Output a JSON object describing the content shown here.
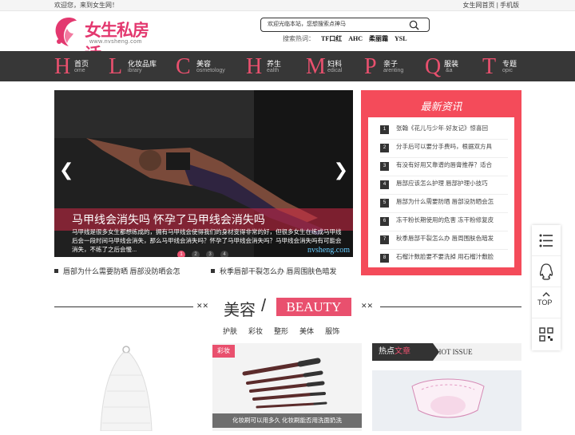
{
  "topbar": {
    "welcome": "欢迎您，来到女生网！",
    "home_link": "女生网首页",
    "sep": " | ",
    "mobile_link": "手机版"
  },
  "logo": {
    "title": "女生私房话",
    "url": "www.nvsheng.com"
  },
  "search": {
    "placeholder": "欢迎光临本站，您想搜索点神马",
    "hot_label": "搜索热词：",
    "hot_words": [
      "TF口红",
      "AHC",
      "柔丽霜",
      "YSL"
    ]
  },
  "nav": [
    {
      "letter": "H",
      "cn": "首页",
      "en": "ome"
    },
    {
      "letter": "L",
      "cn": "化妆品库",
      "en": "ibrary"
    },
    {
      "letter": "C",
      "cn": "美容",
      "en": "osmetology"
    },
    {
      "letter": "H",
      "cn": "养生",
      "en": "ealth"
    },
    {
      "letter": "M",
      "cn": "妇科",
      "en": "edical"
    },
    {
      "letter": "P",
      "cn": "亲子",
      "en": "arenting"
    },
    {
      "letter": "Q",
      "cn": "服装",
      "en": "&a"
    },
    {
      "letter": "T",
      "cn": "专题",
      "en": "opic"
    }
  ],
  "slider": {
    "title": "马甲线会消失吗 怀孕了马甲线会消失吗",
    "desc": "马甲线是很多女生都想练成的，拥有马甲线会使得我们的身材变得非常的好，但很多女生在练成马甲线后会一段时间马甲线会消失，那么马甲线会消失吗？怀孕了马甲线会消失吗？马甲线会消失吗有可能会消失，不练了之后会慢...",
    "dots": [
      "1",
      "2",
      "3",
      "4"
    ],
    "watermark": "nvsheng.com",
    "prev": "❮",
    "next": "❯"
  },
  "links": [
    "唇部为什么需要防晒 唇部没防晒会怎",
    "秋季唇部干裂怎么办 唇周围肤色暗发"
  ],
  "news": {
    "heading": "最新资讯",
    "items": [
      {
        "n": "1",
        "text": "张翰《花儿与少年·好友记》惊喜回"
      },
      {
        "n": "2",
        "text": "分手后可以要分手费吗，根据双方具"
      },
      {
        "n": "3",
        "text": "有没有好用又靠谱的唇膏推荐？适合"
      },
      {
        "n": "4",
        "text": "唇部应该怎么护理 唇部护理小技巧"
      },
      {
        "n": "5",
        "text": "唇部为什么需要防晒 唇部没防晒会怎"
      },
      {
        "n": "6",
        "text": "冻干粉长期使用的危害 冻干粉修复皮"
      },
      {
        "n": "7",
        "text": "秋季唇部干裂怎么办 唇周围肤色暗发"
      },
      {
        "n": "8",
        "text": "石榴汁数脸要不要洗掉 用石榴汁敷脸"
      }
    ]
  },
  "side": {
    "top_label": "TOP"
  },
  "section": {
    "cn": "美容",
    "slash": "/",
    "en": "BEAUTY",
    "deco": "✕✕",
    "tabs": [
      "护肤",
      "彩妆",
      "整形",
      "美体",
      "服饰"
    ]
  },
  "card2": {
    "tag": "彩妆",
    "caption": "化妆刷可以用多久 化妆刷能否用洗面奶洗"
  },
  "card3": {
    "h1a": "热点",
    "h1b": "文章",
    "h2": "HOT ISSUE"
  },
  "colors": {
    "accent": "#e9506e",
    "news_bg": "#f44b5a",
    "nav_bg": "#373737"
  }
}
